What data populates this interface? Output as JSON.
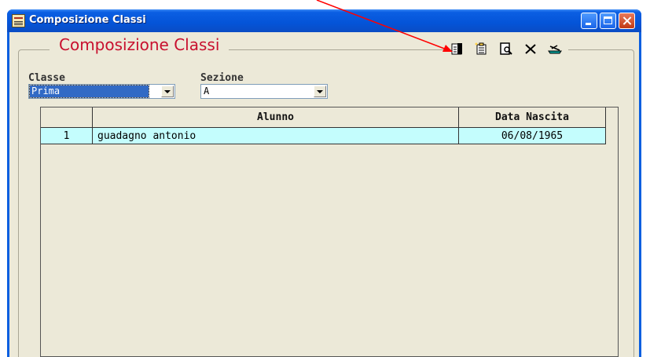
{
  "window": {
    "title": "Composizione Classi",
    "buttons": [
      "minimize",
      "maximize",
      "close"
    ]
  },
  "form": {
    "group_title": "Composizione Classi",
    "toolbar": [
      {
        "name": "new-record-icon"
      },
      {
        "name": "paste-icon"
      },
      {
        "name": "print-preview-icon"
      },
      {
        "name": "delete-icon"
      },
      {
        "name": "exit-icon"
      }
    ],
    "classe": {
      "label": "Classe",
      "value": "Prima"
    },
    "sezione": {
      "label": "Sezione",
      "value": "A"
    }
  },
  "grid": {
    "columns": [
      "",
      "Alunno",
      "Data Nascita"
    ],
    "rows": [
      {
        "num": "1",
        "alunno": "guadagno antonio",
        "data_nascita": "06/08/1965"
      }
    ]
  },
  "colors": {
    "title_accent": "#c8102e",
    "row_highlight": "#c4fdfd",
    "selection": "#316ac5",
    "annotation_arrow": "#ff0000"
  }
}
